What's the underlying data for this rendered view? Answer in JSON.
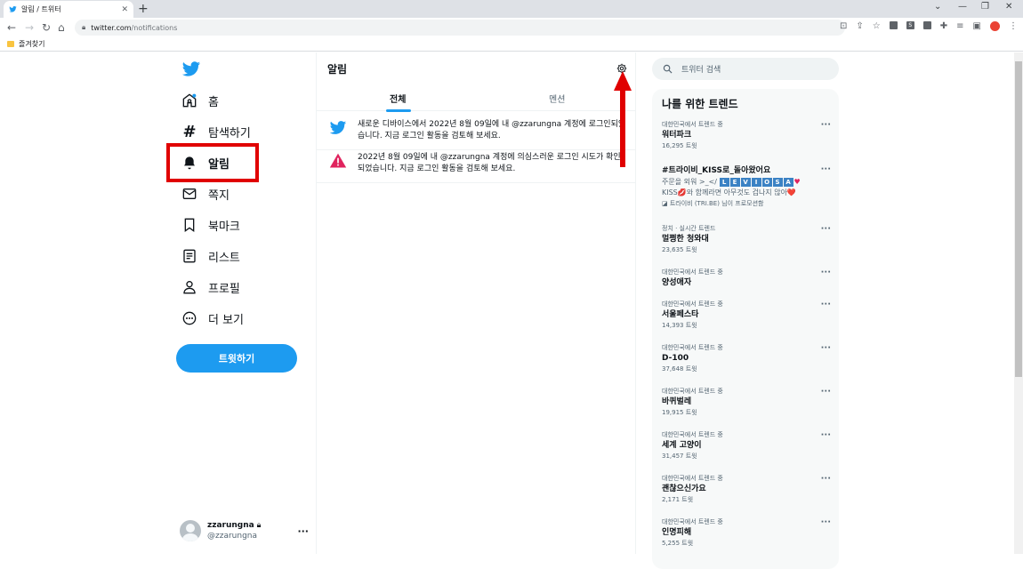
{
  "browser": {
    "tab_title": "알림 / 트위터",
    "tab_close": "✕",
    "new_tab": "+",
    "url_host": "twitter.com",
    "url_path": "/notifications",
    "bookmark_folder": "즐겨찾기",
    "window_controls": [
      "⌄",
      "—",
      "❐",
      "✕"
    ]
  },
  "nav": {
    "items": [
      {
        "label": "홈",
        "icon": "home-icon"
      },
      {
        "label": "탐색하기",
        "icon": "hashtag-icon"
      },
      {
        "label": "알림",
        "icon": "bell-icon"
      },
      {
        "label": "쪽지",
        "icon": "mail-icon"
      },
      {
        "label": "북마크",
        "icon": "bookmark-icon"
      },
      {
        "label": "리스트",
        "icon": "list-icon"
      },
      {
        "label": "프로필",
        "icon": "profile-icon"
      },
      {
        "label": "더 보기",
        "icon": "more-circle-icon"
      }
    ],
    "tweet_button": "트윗하기",
    "account": {
      "name": "zzarungna",
      "handle": "@zzarungna",
      "more": "···"
    }
  },
  "main": {
    "title": "알림",
    "tabs": [
      "전체",
      "멘션"
    ],
    "notifications": [
      {
        "icon": "twitter-bird-icon",
        "text": "새로운 디바이스에서 2022년 8월 09일에 내 @zzarungna 계정에 로그인되었습니다. 지금 로그인 활동을 검토해 보세요."
      },
      {
        "icon": "alert-icon",
        "text": "2022년 8월 09일에 내 @zzarungna 계정에 의심스러운 로그인 시도가 확인되었습니다. 지금 로그인 활동을 검토해 보세요."
      }
    ]
  },
  "search": {
    "placeholder": "트위터 검색"
  },
  "trends": {
    "title": "나를 위한 트렌드",
    "more": "···",
    "promoted": {
      "name": "#트라이비_KISS로_돌아왔어요",
      "desc_prefix": "주문을 외워 >_</",
      "levs": [
        "L",
        "E",
        "V",
        "I",
        "O",
        "S",
        "A"
      ],
      "desc_line2": "KISS💋와 함께라면 아무것도 겁나지 않아❤️",
      "promo": "트라이비 (TRI.BE) 님이 프로모션함"
    },
    "items": [
      {
        "ctx": "대한민국에서 트렌드 중",
        "name": "워터파크",
        "count": "16,295 트윗"
      },
      {
        "ctx": "정치 · 실시간 트렌드",
        "name": "멀쩡한 청와대",
        "count": "23,635 트윗"
      },
      {
        "ctx": "대한민국에서 트렌드 중",
        "name": "양성애자",
        "count": ""
      },
      {
        "ctx": "대한민국에서 트렌드 중",
        "name": "서울페스타",
        "count": "14,393 트윗"
      },
      {
        "ctx": "대한민국에서 트렌드 중",
        "name": "D-100",
        "count": "37,648 트윗"
      },
      {
        "ctx": "대한민국에서 트렌드 중",
        "name": "바퀴벌레",
        "count": "19,915 트윗"
      },
      {
        "ctx": "대한민국에서 트렌드 중",
        "name": "세계 고양이",
        "count": "31,457 트윗"
      },
      {
        "ctx": "대한민국에서 트렌드 중",
        "name": "괜찮으신가요",
        "count": "2,171 트윗"
      },
      {
        "ctx": "대한민국에서 트렌드 중",
        "name": "인명피해",
        "count": "5,255 트윗"
      }
    ]
  },
  "colors": {
    "brand": "#1d9bf0",
    "highlight": "#e00000",
    "alert": "#e0245e"
  }
}
